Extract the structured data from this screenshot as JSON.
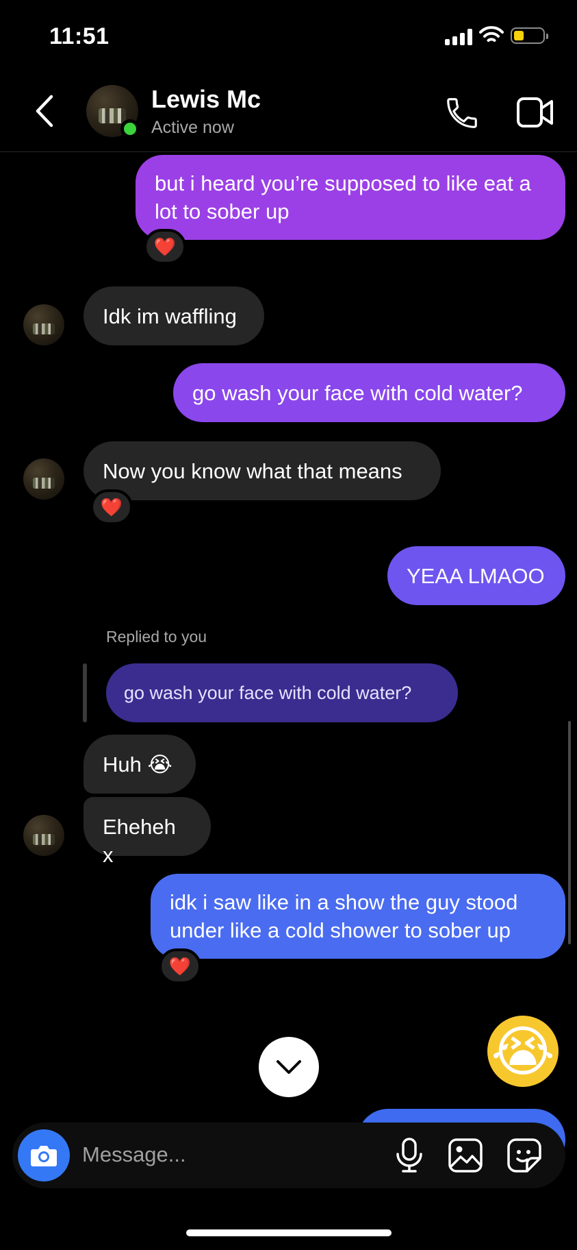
{
  "status_bar": {
    "time": "11:51"
  },
  "header": {
    "contact_name": "Lewis Mc",
    "contact_status": "Active now"
  },
  "messages": [
    {
      "from": "me",
      "text": "but i heard you’re supposed to like eat a lot to sober up",
      "reaction": "❤️"
    },
    {
      "from": "them",
      "text": "Idk im waffling"
    },
    {
      "from": "me",
      "text": "go wash your face with cold water?"
    },
    {
      "from": "them",
      "text": "Now you know what that means",
      "reaction": "❤️"
    },
    {
      "from": "me",
      "text": "YEAA LMAOO"
    },
    {
      "from": "them",
      "replied_label": "Replied to you",
      "quoted_text": "go wash your face with cold water?",
      "text": "Huh 😭"
    },
    {
      "from": "them",
      "text": "Eheheh x"
    },
    {
      "from": "me",
      "text": "idk i saw like in a show the guy stood under like a cold shower to sober up",
      "reaction": "❤️"
    },
    {
      "from": "me",
      "emoji": "😭"
    }
  ],
  "composer": {
    "placeholder": "Message..."
  },
  "icons": {
    "back": "chevron-left-icon",
    "call": "phone-icon",
    "video": "video-camera-icon",
    "camera": "camera-icon",
    "mic": "microphone-icon",
    "gallery": "image-icon",
    "sticker": "sticker-icon",
    "scroll_down": "chevron-down-icon"
  },
  "colors": {
    "sent_top": "#9b40e6",
    "sent_mid": "#7b4ef0",
    "sent_bottom": "#4a6cf0",
    "received": "#262626",
    "reply_quote": "#3a2d8f",
    "online": "#3cd23c",
    "camera_button": "#3478f6"
  }
}
